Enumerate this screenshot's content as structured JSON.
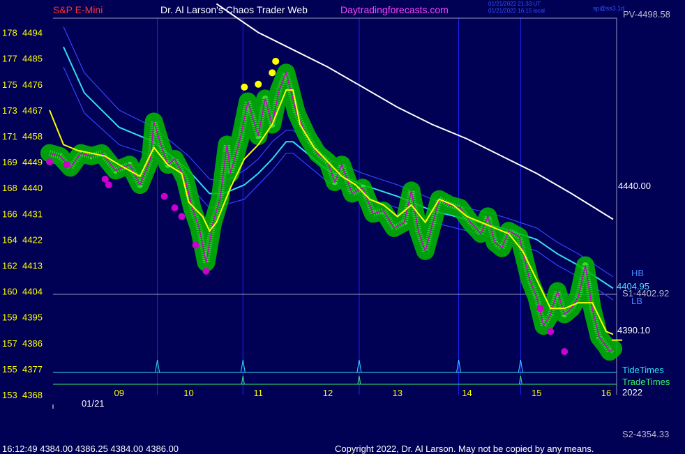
{
  "header": {
    "symbol": "S&P E-Mini",
    "site": "Dr. Al Larson's Chaos Trader Web",
    "url": "Daytradingforecasts.com",
    "stamp1": "01/21/2022 21:33 UT",
    "stamp2": "01/21/2022 16:15 local",
    "corner": "sp@ss3.1d"
  },
  "footer": {
    "ohlc": "16:12:49  4384.00 4386.25 4384.00 4386.00",
    "copyright": "Copyright 2022, Dr. Al Larson. May not be copied by any means."
  },
  "levels": {
    "pv": "PV-4498.58",
    "s1": "S1-4402.92",
    "s2": "S2-4354.33",
    "s1_value": 4402.92,
    "hb": "HB",
    "lb": "LB",
    "white_line_end": "4440.00",
    "channel_end": "4404.95",
    "price_end": "4390.10"
  },
  "panels": {
    "tide_label": "TideTimes",
    "trade_label": "TradeTimes"
  },
  "colors": {
    "background": "#000055",
    "price": "#33dd33",
    "glow": "#00bb00",
    "yellow": "#ffff00",
    "magenta": "#cc00cc",
    "cyan": "#33ddee",
    "white": "#ffffff",
    "blue_vlines": "#2222ff"
  },
  "chart_data": {
    "type": "line",
    "title": "S&P E-Mini",
    "date_label": "01/21",
    "year_label": "2022",
    "ylim": [
      4368,
      4499
    ],
    "xlim": [
      8.05,
      16.15
    ],
    "y_ticks": [
      {
        "left": "178",
        "right": "4494"
      },
      {
        "left": "177",
        "right": "4485"
      },
      {
        "left": "175",
        "right": "4476"
      },
      {
        "left": "173",
        "right": "4467"
      },
      {
        "left": "171",
        "right": "4458"
      },
      {
        "left": "169",
        "right": "4449"
      },
      {
        "left": "168",
        "right": "4440"
      },
      {
        "left": "166",
        "right": "4431"
      },
      {
        "left": "164",
        "right": "4422"
      },
      {
        "left": "162",
        "right": "4413"
      },
      {
        "left": "160",
        "right": "4404"
      },
      {
        "left": "159",
        "right": "4395"
      },
      {
        "left": "157",
        "right": "4386"
      },
      {
        "left": "155",
        "right": "4377"
      },
      {
        "left": "153",
        "right": "4368"
      }
    ],
    "x_ticks": [
      {
        "label": "09",
        "x": 9.0
      },
      {
        "label": "10",
        "x": 10.0
      },
      {
        "label": "11",
        "x": 11.0
      },
      {
        "label": "12",
        "x": 12.0
      },
      {
        "label": "13",
        "x": 13.0
      },
      {
        "label": "14",
        "x": 14.0
      },
      {
        "label": "15",
        "x": 15.0
      },
      {
        "label": "16",
        "x": 16.0
      }
    ],
    "event_times": [
      9.55,
      10.78,
      12.45,
      13.88,
      14.77
    ],
    "trade_times": [
      10.78,
      12.45,
      14.77
    ],
    "series": [
      {
        "kind": "price",
        "x": [
          8.0,
          8.15,
          8.3,
          8.45,
          8.6,
          8.75,
          8.95,
          9.15,
          9.3,
          9.45,
          9.5,
          9.6,
          9.7,
          9.8,
          9.95,
          10.05,
          10.15,
          10.25,
          10.35,
          10.45,
          10.55,
          10.6,
          10.75,
          10.85,
          11.0,
          11.1,
          11.2,
          11.3,
          11.4,
          11.55,
          11.7,
          11.85,
          12.0,
          12.1,
          12.2,
          12.35,
          12.5,
          12.65,
          12.8,
          12.95,
          13.1,
          13.2,
          13.3,
          13.4,
          13.5,
          13.6,
          13.75,
          13.9,
          14.05,
          14.2,
          14.3,
          14.4,
          14.5,
          14.6,
          14.75,
          14.9,
          15.0,
          15.1,
          15.2,
          15.3,
          15.4,
          15.5,
          15.6,
          15.7,
          15.8,
          15.9,
          16.0,
          16.05,
          16.1
        ],
        "y": [
          4452,
          4451,
          4447,
          4452,
          4451,
          4452,
          4446,
          4448,
          4441,
          4450,
          4463,
          4455,
          4448,
          4450,
          4443,
          4433,
          4426,
          4414,
          4428,
          4436,
          4455,
          4445,
          4458,
          4470,
          4458,
          4471,
          4462,
          4474,
          4480,
          4466,
          4458,
          4452,
          4449,
          4442,
          4448,
          4438,
          4440,
          4431,
          4432,
          4426,
          4428,
          4439,
          4425,
          4418,
          4427,
          4436,
          4434,
          4433,
          4428,
          4424,
          4430,
          4421,
          4419,
          4425,
          4423,
          4408,
          4402,
          4392,
          4396,
          4404,
          4396,
          4398,
          4402,
          4413,
          4398,
          4388,
          4385,
          4383,
          4384
        ]
      },
      {
        "kind": "yellow",
        "x": [
          8.0,
          8.2,
          8.4,
          8.6,
          8.8,
          9.0,
          9.3,
          9.5,
          9.7,
          9.9,
          10.0,
          10.2,
          10.3,
          10.4,
          10.6,
          10.8,
          11.0,
          11.2,
          11.4,
          11.5,
          11.6,
          11.8,
          12.0,
          12.2,
          12.4,
          12.6,
          12.8,
          13.0,
          13.2,
          13.4,
          13.6,
          13.8,
          14.0,
          14.2,
          14.4,
          14.6,
          14.8,
          15.0,
          15.2,
          15.4,
          15.6,
          15.8,
          16.0,
          16.1
        ],
        "y": [
          4467,
          4455,
          4453,
          4452,
          4451,
          4448,
          4444,
          4454,
          4448,
          4445,
          4435,
          4430,
          4425,
          4428,
          4440,
          4450,
          4455,
          4462,
          4474,
          4474,
          4462,
          4454,
          4449,
          4444,
          4441,
          4436,
          4434,
          4430,
          4434,
          4428,
          4436,
          4434,
          4430,
          4428,
          4426,
          4424,
          4418,
          4408,
          4398,
          4398,
          4400,
          4400,
          4390,
          4389
        ]
      },
      {
        "kind": "white",
        "x": [
          10.4,
          11.0,
          11.5,
          12.0,
          12.5,
          13.0,
          13.5,
          14.0,
          14.5,
          15.0,
          15.5,
          16.1
        ],
        "y": [
          4504,
          4494,
          4488,
          4482,
          4475,
          4468,
          4462,
          4457,
          4451,
          4445,
          4438,
          4429
        ]
      },
      {
        "kind": "cyan",
        "x": [
          8.2,
          8.5,
          9.0,
          9.5,
          10.0,
          10.3,
          10.5,
          10.8,
          11.0,
          11.2,
          11.4,
          11.5,
          11.7,
          12.0,
          12.5,
          13.0,
          13.5,
          14.0,
          14.5,
          15.0,
          15.3,
          15.6,
          16.1
        ],
        "y": [
          4489,
          4473,
          4461,
          4456,
          4446,
          4438,
          4438,
          4441,
          4445,
          4450,
          4456,
          4456,
          4452,
          4446,
          4441,
          4437,
          4432,
          4429,
          4426,
          4422,
          4417,
          4413,
          4405
        ]
      },
      {
        "kind": "upper_band",
        "x": [
          8.2,
          8.5,
          9.0,
          9.5,
          10.0,
          10.3,
          10.5,
          10.8,
          11.0,
          11.2,
          11.4,
          11.5,
          11.7,
          12.0,
          12.5,
          13.0,
          13.5,
          14.0,
          14.5,
          15.0,
          15.3,
          15.6,
          16.1
        ],
        "y": [
          4496,
          4480,
          4467,
          4461,
          4451,
          4443,
          4442,
          4446,
          4450,
          4456,
          4460,
          4460,
          4456,
          4450,
          4445,
          4441,
          4436,
          4433,
          4430,
          4426,
          4421,
          4417,
          4409
        ]
      },
      {
        "kind": "lower_band",
        "x": [
          8.2,
          8.5,
          9.0,
          9.5,
          10.0,
          10.3,
          10.5,
          10.8,
          11.0,
          11.2,
          11.4,
          11.5,
          11.7,
          12.0,
          12.5,
          13.0,
          13.5,
          14.0,
          14.5,
          15.0,
          15.3,
          15.6,
          16.1
        ],
        "y": [
          4482,
          4466,
          4455,
          4451,
          4441,
          4433,
          4434,
          4436,
          4441,
          4446,
          4452,
          4452,
          4448,
          4442,
          4437,
          4433,
          4428,
          4425,
          4422,
          4418,
          4413,
          4409,
          4401
        ]
      },
      {
        "kind": "magenta_dots",
        "x": [
          8.0,
          8.25,
          8.8,
          8.85,
          9.65,
          9.8,
          9.9,
          10.1,
          10.25,
          15.05,
          15.2,
          15.4
        ],
        "y": [
          4449,
          4448,
          4443,
          4441,
          4437,
          4433,
          4430,
          4420,
          4411,
          4398,
          4390,
          4383
        ]
      },
      {
        "kind": "yellow_dots",
        "x": [
          10.8,
          11.0,
          11.2,
          11.25
        ],
        "y": [
          4475,
          4476,
          4480,
          4484
        ]
      }
    ]
  }
}
